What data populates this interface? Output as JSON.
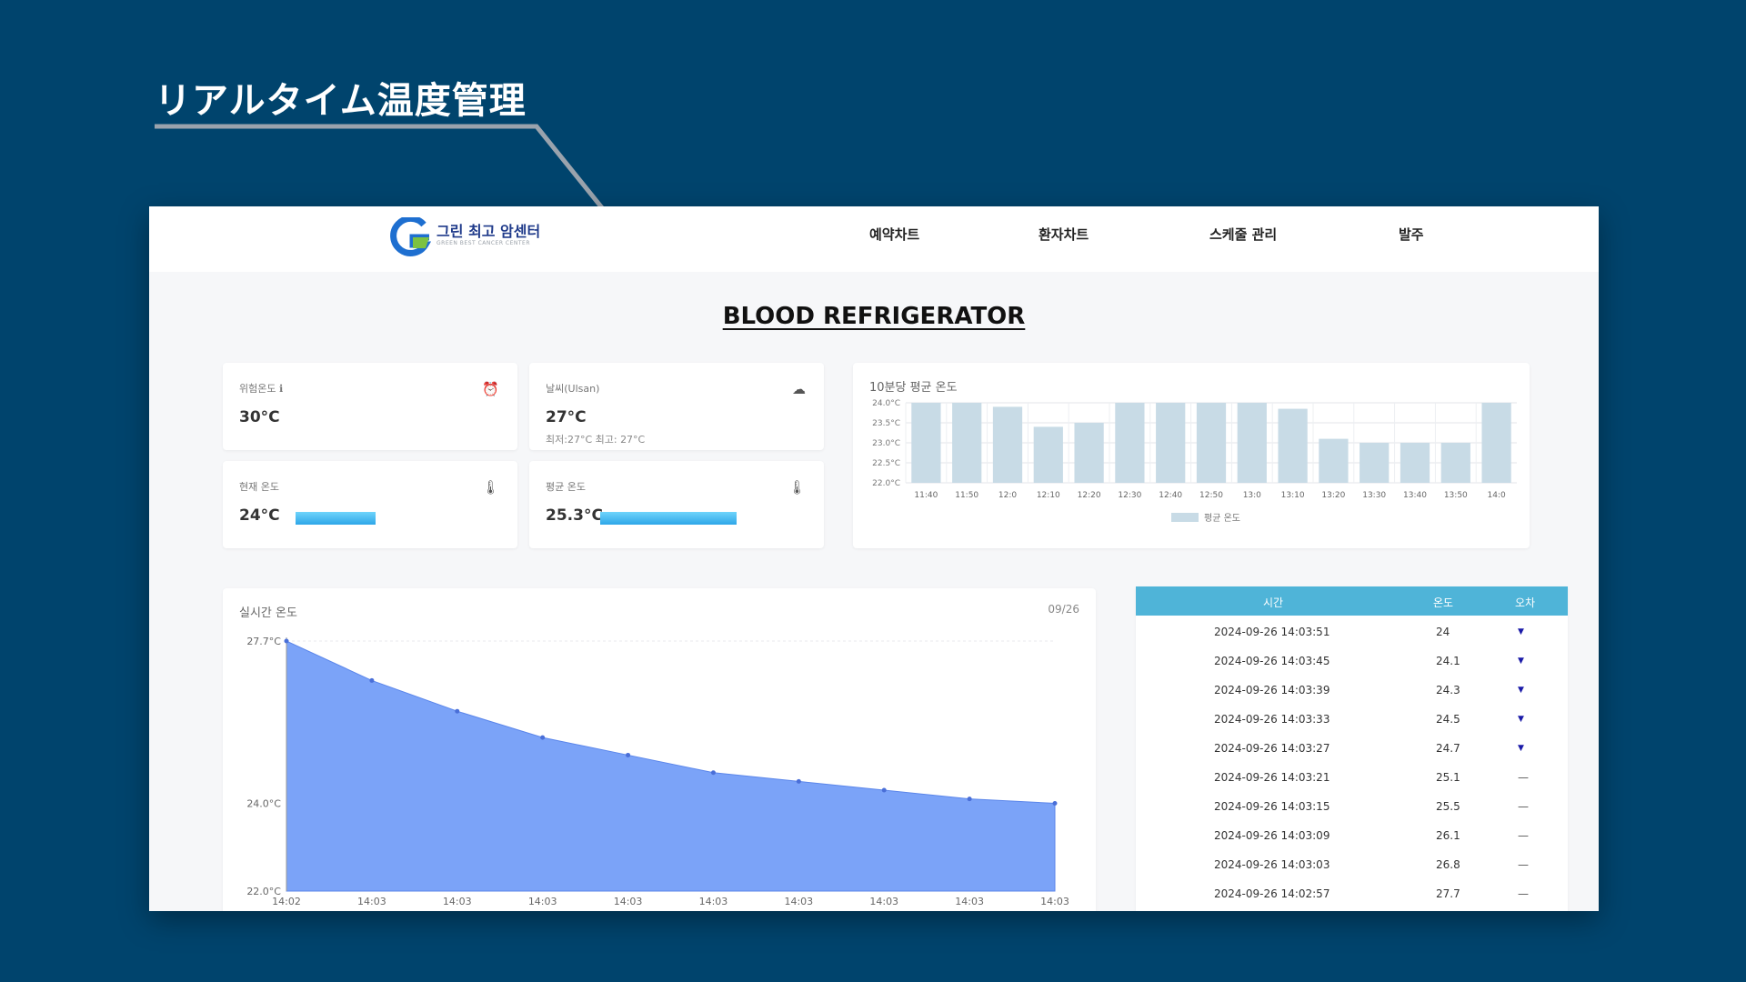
{
  "slide": {
    "title": "リアルタイム温度管理"
  },
  "logo": {
    "name": "그린 최고 암센터",
    "subtitle": "GREEN BEST CANCER CENTER"
  },
  "nav": [
    {
      "label": "예약차트"
    },
    {
      "label": "환자차트"
    },
    {
      "label": "스케줄 관리"
    },
    {
      "label": "발주"
    }
  ],
  "page": {
    "title": "BLOOD REFRIGERATOR"
  },
  "cards": {
    "risk": {
      "label": "위험온도 ℹ",
      "value": "30°C",
      "icon": "alarm-icon"
    },
    "weather": {
      "label": "날씨(Ulsan)",
      "value": "27°C",
      "sub": "최저:27°C 최고: 27°C",
      "icon": "weather-icon"
    },
    "current": {
      "label": "현재 온도",
      "value": "24°C",
      "level": 0.35,
      "icon": "thermometer-icon"
    },
    "average": {
      "label": "평균 온도",
      "value": "25.3°C",
      "level": 0.6,
      "icon": "thermometer-icon"
    }
  },
  "bar_chart_title": "10분당 평균 온도",
  "line_chart": {
    "title": "실시간 온도",
    "date": "09/26"
  },
  "table": {
    "headers": [
      "시간",
      "온도",
      "오차"
    ],
    "rows": [
      {
        "time": "2024-09-26 14:03:51",
        "temp": "24",
        "trend": "down"
      },
      {
        "time": "2024-09-26 14:03:45",
        "temp": "24.1",
        "trend": "down"
      },
      {
        "time": "2024-09-26 14:03:39",
        "temp": "24.3",
        "trend": "down"
      },
      {
        "time": "2024-09-26 14:03:33",
        "temp": "24.5",
        "trend": "down"
      },
      {
        "time": "2024-09-26 14:03:27",
        "temp": "24.7",
        "trend": "down"
      },
      {
        "time": "2024-09-26 14:03:21",
        "temp": "25.1",
        "trend": "flat"
      },
      {
        "time": "2024-09-26 14:03:15",
        "temp": "25.5",
        "trend": "flat"
      },
      {
        "time": "2024-09-26 14:03:09",
        "temp": "26.1",
        "trend": "flat"
      },
      {
        "time": "2024-09-26 14:03:03",
        "temp": "26.8",
        "trend": "flat"
      },
      {
        "time": "2024-09-26 14:02:57",
        "temp": "27.7",
        "trend": "flat"
      }
    ]
  },
  "colors": {
    "background": "#00446d",
    "bar": "#c8dbe6",
    "area": "#7ba3f8",
    "table_header": "#4fb4d8",
    "trend_down": "#1a1aa8"
  },
  "chart_data": [
    {
      "type": "bar",
      "title": "10분당 평균 온도",
      "categories": [
        "11:40",
        "11:50",
        "12:0",
        "12:10",
        "12:20",
        "12:30",
        "12:40",
        "12:50",
        "13:0",
        "13:10",
        "13:20",
        "13:30",
        "13:40",
        "13:50",
        "14:0"
      ],
      "series": [
        {
          "name": "평균 온도",
          "values": [
            24.0,
            24.0,
            23.9,
            23.4,
            23.5,
            24.0,
            24.0,
            24.0,
            24.0,
            23.85,
            23.1,
            23.0,
            23.0,
            23.0,
            24.0
          ]
        }
      ],
      "yticks": [
        "24.0°C",
        "23.5°C",
        "23.0°C",
        "22.5°C",
        "22.0°C"
      ],
      "ylim": [
        22.0,
        24.0
      ],
      "grid": true,
      "legend": "bottom"
    },
    {
      "type": "area",
      "title": "실시간 온도",
      "x": [
        "14:02",
        "14:03",
        "14:03",
        "14:03",
        "14:03",
        "14:03",
        "14:03",
        "14:03",
        "14:03",
        "14:03"
      ],
      "series": [
        {
          "values": [
            27.7,
            26.8,
            26.1,
            25.5,
            25.1,
            24.7,
            24.5,
            24.3,
            24.1,
            24.0
          ]
        }
      ],
      "yticks": [
        "27.7°C",
        "24.0°C",
        "22.0°C"
      ],
      "ylim": [
        22.0,
        27.7
      ]
    }
  ]
}
